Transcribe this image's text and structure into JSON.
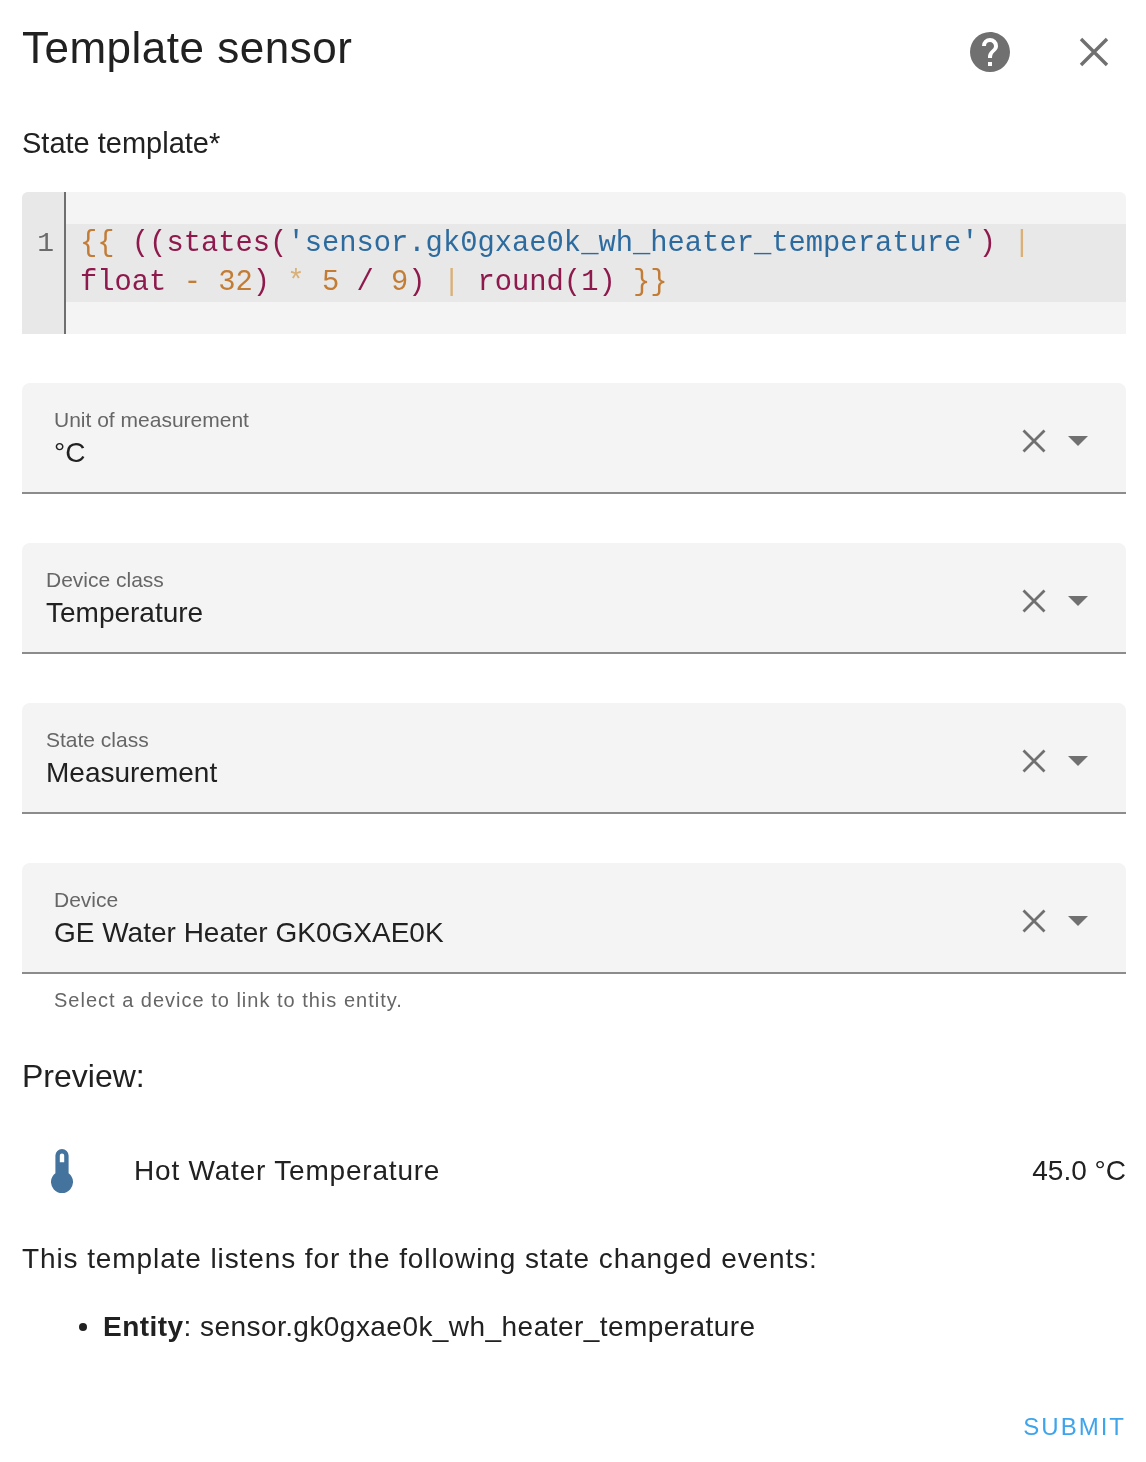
{
  "dialog": {
    "title": "Template sensor"
  },
  "state_template": {
    "label": "State template*",
    "line_numbers": [
      "1"
    ],
    "tokens": [
      {
        "text": "{{",
        "kind": "delimiter"
      },
      {
        "text": " ((states(",
        "kind": "keyword"
      },
      {
        "text": "'sensor.gk0gxae0k_wh_heater_temperature'",
        "kind": "string"
      },
      {
        "text": ")",
        "kind": "keyword"
      },
      {
        "text": " |",
        "kind": "symbol"
      },
      {
        "text": " float",
        "kind": "keyword"
      },
      {
        "text": " -",
        "kind": "operator"
      },
      {
        "text": " 32",
        "kind": "number"
      },
      {
        "text": ")",
        "kind": "keyword"
      },
      {
        "text": " *",
        "kind": "symbol"
      },
      {
        "text": " 5",
        "kind": "number"
      },
      {
        "text": " /",
        "kind": "keyword"
      },
      {
        "text": " 9",
        "kind": "number"
      },
      {
        "text": ")",
        "kind": "keyword"
      },
      {
        "text": " |",
        "kind": "symbol"
      },
      {
        "text": " round(1)",
        "kind": "keyword"
      },
      {
        "text": " }}",
        "kind": "delimiter"
      }
    ]
  },
  "fields": [
    {
      "kind": "combo",
      "label": "Unit of measurement",
      "value": "°C"
    },
    {
      "kind": "select",
      "label": "Device class",
      "value": "Temperature"
    },
    {
      "kind": "select",
      "label": "State class",
      "value": "Measurement"
    },
    {
      "kind": "combo",
      "label": "Device",
      "value": "GE Water Heater GK0GXAE0K",
      "helper": "Select a device to link to this entity."
    }
  ],
  "preview": {
    "heading": "Preview:",
    "entity": {
      "name": "Hot Water Temperature",
      "state": "45.0 °C"
    }
  },
  "listeners": {
    "intro": "This template listens for the following state changed events:",
    "events": [
      "**Entity**: sensor.gk0gxae0k_wh_heater_temperature"
    ]
  },
  "submit": "SUBMIT"
}
